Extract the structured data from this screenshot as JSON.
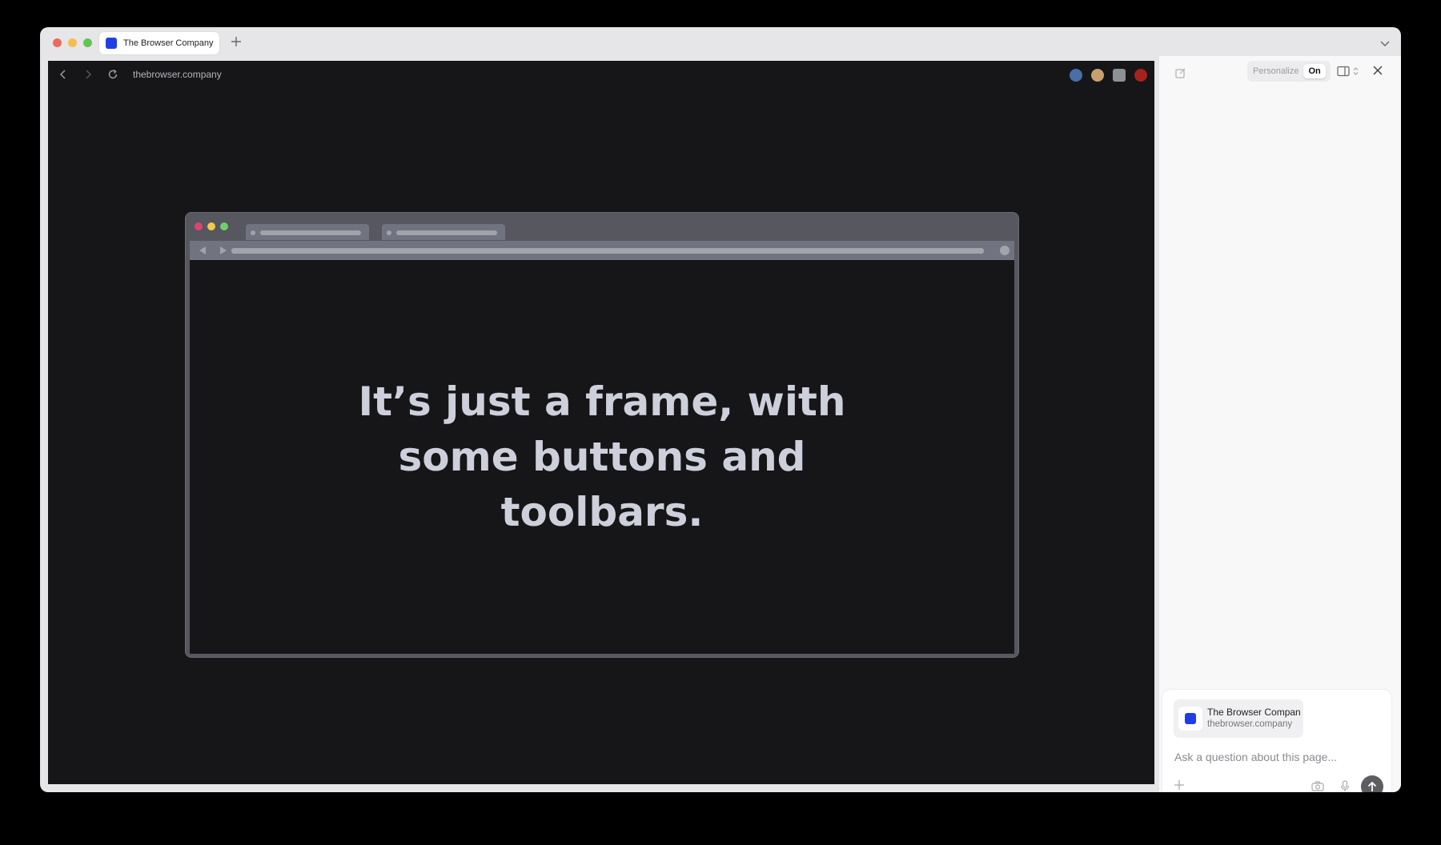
{
  "window": {
    "tab": {
      "title": "The Browser Company",
      "favicon_color": "#1f3fe5"
    },
    "new_tab_icon": "plus-icon",
    "tabs_menu_icon": "chevron-down-icon"
  },
  "navbar": {
    "url": "thebrowser.company",
    "back_icon": "chevron-left-icon",
    "forward_icon": "chevron-right-icon",
    "reload_icon": "reload-icon",
    "extensions": [
      {
        "name": "vpn-extension-icon",
        "color": "#4a6ea8"
      },
      {
        "name": "avatar-extension-icon",
        "color": "#c8a070"
      },
      {
        "name": "bookmark-extension-icon",
        "color": "#8f9096"
      },
      {
        "name": "ublock-extension-icon",
        "color": "#a4231c"
      }
    ]
  },
  "page": {
    "headline": "It’s just a frame, with some buttons and toolbars.",
    "colors": {
      "background": "#161618",
      "mock_frame": "#56575f",
      "headline": "#cdcfdb"
    }
  },
  "sidepanel": {
    "personalize_label": "Personalize",
    "personalize_state": "On",
    "context": {
      "title": "The Browser Company",
      "url": "thebrowser.company"
    },
    "input_placeholder": "Ask a question about this page..."
  }
}
